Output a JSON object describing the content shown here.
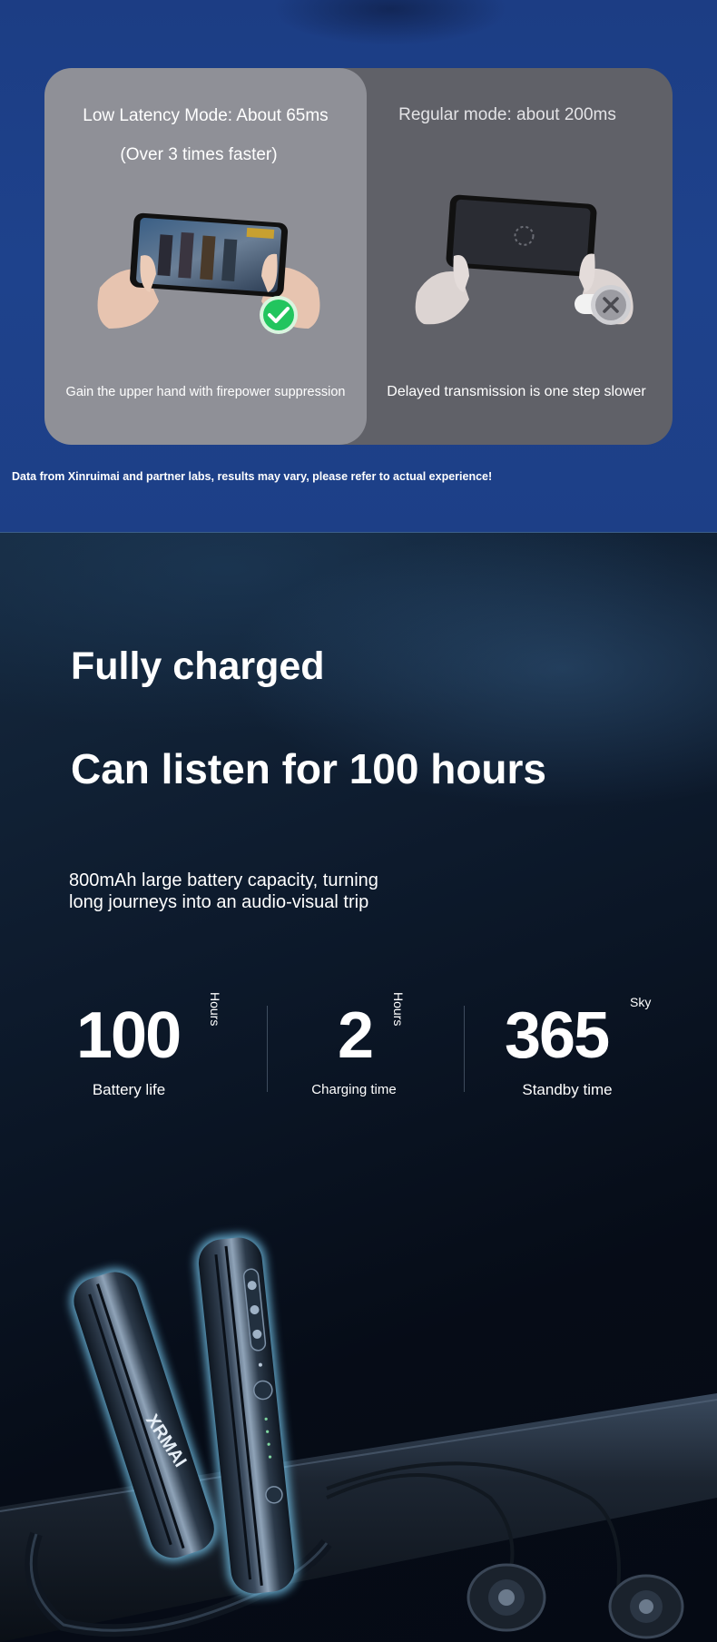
{
  "latency": {
    "low_title": "Low Latency Mode: About 65ms",
    "low_sub": "(Over 3 times faster)",
    "regular_title": "Regular mode: about 200ms",
    "low_caption": "Gain the upper hand with firepower suppression",
    "regular_caption": "Delayed transmission is one step slower",
    "disclaimer": "Data from Xinruimai and partner labs, results may vary, please refer to actual experience!"
  },
  "battery": {
    "headline1": "Fully charged",
    "headline2": "Can listen for 100 hours",
    "description_line1": "800mAh large battery capacity, turning",
    "description_line2": "long journeys into an audio-visual trip",
    "stats": [
      {
        "value": "100",
        "unit": "Hours",
        "label": "Battery life"
      },
      {
        "value": "2",
        "unit": "Hours",
        "label": "Charging time"
      },
      {
        "value": "365",
        "unit": "Sky",
        "label": "Standby time"
      }
    ]
  },
  "brand_logo_text": "XRMAI",
  "colors": {
    "accent_glow": "#7fd6ff",
    "check_green": "#22c55e",
    "panel_light": "#8f9097",
    "panel_dark": "#606168"
  }
}
